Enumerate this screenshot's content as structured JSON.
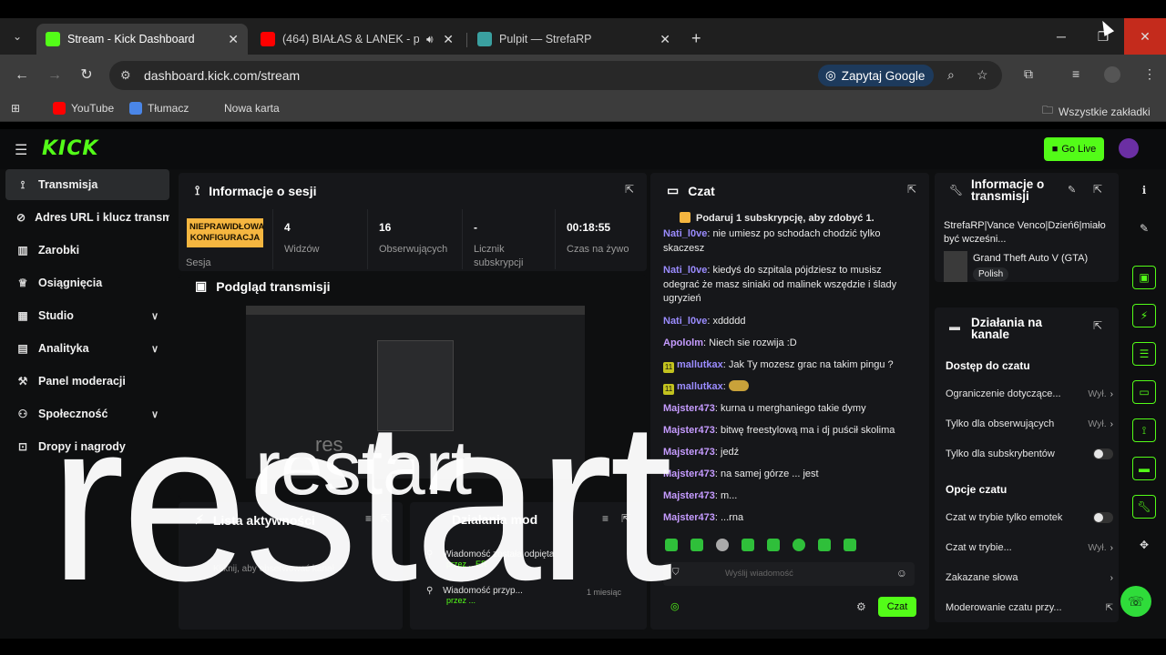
{
  "browser": {
    "tabs": [
      {
        "title": "Stream - Kick Dashboard",
        "active": true
      },
      {
        "title": "(464) BIAŁAS & LANEK - pr..."
      },
      {
        "title": "Pulpit — StrefaRP"
      }
    ],
    "url": "dashboard.kick.com/stream",
    "ask_google": "Zapytaj Google",
    "bookmarks": [
      "YouTube",
      "Tłumacz",
      "Nowa karta"
    ],
    "all_bookmarks": "Wszystkie zakładki"
  },
  "kick": {
    "logo": "KICK",
    "go_live": "Go Live",
    "sidebar": [
      {
        "label": "Transmisja",
        "icon": "broadcast-icon"
      },
      {
        "label": "Adres URL i klucz transmisji",
        "icon": "link-icon"
      },
      {
        "label": "Zarobki",
        "icon": "chart-icon"
      },
      {
        "label": "Osiągnięcia",
        "icon": "trophy-icon"
      },
      {
        "label": "Studio",
        "icon": "studio-icon"
      },
      {
        "label": "Analityka",
        "icon": "analytics-icon"
      },
      {
        "label": "Panel moderacji",
        "icon": "hammer-icon"
      },
      {
        "label": "Społeczność",
        "icon": "community-icon"
      },
      {
        "label": "Dropy i nagrody",
        "icon": "gift-icon"
      }
    ],
    "session": {
      "title": "Informacje o sesji",
      "warning": "NIEPRAWIDŁOWA KONFIGURACJA",
      "session_label": "Sesja",
      "stats": [
        {
          "value": "4",
          "label": "Widzów"
        },
        {
          "value": "16",
          "label": "Obserwujących"
        },
        {
          "value": "-",
          "label": "Licznik subskrypcji"
        },
        {
          "value": "00:18:55",
          "label": "Czas na żywo"
        }
      ]
    },
    "preview_title": "Podgląd transmisji",
    "lower_left": {
      "title": "Lista aktywności",
      "item": "Kliknij, aby obserwować kanał"
    },
    "lower_mid": {
      "title": "Działania mod",
      "items": [
        {
          "text": "Wiadomość została odpięta",
          "sub": "przez ...ER"
        },
        {
          "text": "Wiadomość przyp...",
          "sub": "przez ...",
          "extra": "1 miesiąc"
        }
      ]
    },
    "chat": {
      "title": "Czat",
      "promo": "Podaruj 1 subskrypcję, aby zdobyć 1.",
      "messages": [
        {
          "user": "Nati_l0ve",
          "color": "#9b8cff",
          "text": "nie umiesz po schodach chodzić tylko skaczesz"
        },
        {
          "user": "Nati_l0ve",
          "color": "#9b8cff",
          "text": "kiedyś do szpitala pójdziesz to musisz odegrać że masz siniaki od malinek wszędzie i ślady ugryzień"
        },
        {
          "user": "Nati_l0ve",
          "color": "#9b8cff",
          "text": "xddddd"
        },
        {
          "user": "Apololm",
          "color": "#c59bff",
          "text": "Niech sie rozwija :D"
        },
        {
          "user": "mallutkax",
          "color": "#9b8cff",
          "text": "Jak Ty mozesz grac na takim pingu ?",
          "sub": true
        },
        {
          "user": "mallutkax",
          "color": "#9b8cff",
          "text": "",
          "sub": true
        },
        {
          "user": "Majster473",
          "color": "#c59bff",
          "text": "kurna u merghaniego takie dymy"
        },
        {
          "user": "Majster473",
          "color": "#c59bff",
          "text": "bitwę freestylową ma i dj puścił skolima"
        },
        {
          "user": "Majster473",
          "color": "#c59bff",
          "text": "jedź"
        },
        {
          "user": "Majster473",
          "color": "#c59bff",
          "text": "na samej górze ... jest"
        },
        {
          "user": "Majster473",
          "color": "#c59bff",
          "text": "m..."
        },
        {
          "user": "Majster473",
          "color": "#c59bff",
          "text": "...rna"
        }
      ],
      "input_placeholder": "Wyślij wiadomość",
      "send": "Czat"
    },
    "stream_info": {
      "title": "Informacje o transmisji",
      "stream_title": "StrefaRP|Vance Venco|Dzień6|miało być wcześni...",
      "game": "Grand Theft Auto V (GTA)",
      "language": "Polish"
    },
    "channel_actions": {
      "title": "Działania na kanale",
      "chat_access": "Dostęp do czatu",
      "access_rows": [
        {
          "label": "Ograniczenie dotyczące...",
          "value": "Wył.",
          "type": "chevron"
        },
        {
          "label": "Tylko dla obserwujących",
          "value": "Wył.",
          "type": "chevron"
        },
        {
          "label": "Tylko dla subskrybentów",
          "value": "",
          "type": "toggle"
        }
      ],
      "chat_options": "Opcje czatu",
      "option_rows": [
        {
          "label": "Czat w trybie tylko emotek",
          "value": "",
          "type": "toggle"
        },
        {
          "label": "Czat w trybie...",
          "value": "Wył.",
          "type": "chevron"
        },
        {
          "label": "Zakazane słowa",
          "value": "",
          "type": "chevron"
        },
        {
          "label": "Moderowanie czatu przy...",
          "value": "",
          "type": "external"
        }
      ]
    }
  },
  "overlay": {
    "big": "restart",
    "small": "restart",
    "ghost": "res"
  }
}
